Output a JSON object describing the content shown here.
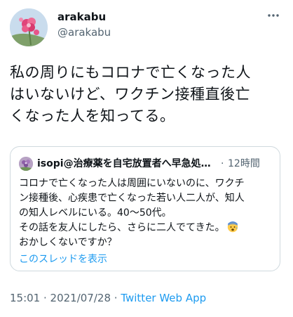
{
  "author": {
    "display_name": "arakabu",
    "handle": "@arakabu",
    "avatar_icon": "flower-avatar-icon"
  },
  "more_icon": "more-horizontal-icon",
  "tweet": {
    "text": "私の周りにもコロナで亡くなった人\nはいないけど、ワクチン接種直後亡\nくなった人を知ってる。"
  },
  "quote": {
    "avatar_icon": "flower-avatar-icon",
    "name": "isopi@治療薬を自宅放置者へ早急処…",
    "separator": "·",
    "time": "12時間",
    "lines": [
      "コロナで亡くなった人は周囲にいないのに、ワクチ",
      "ン接種後、心疾患で亡くなった若い人二人が、知人",
      "の知人レベルにいる。40〜50代。",
      "その話を友人にしたら、さらに二人でてきた。",
      "おかしくないですか？"
    ],
    "emoji_icon": "anxious-face-emoji-icon",
    "show_thread_label": "このスレッドを表示"
  },
  "meta": {
    "time": "15:01 · 2021/07/28",
    "separator": " · ",
    "source": "Twitter Web App"
  },
  "colors": {
    "text": "#0f1419",
    "secondary": "#536471",
    "link": "#1d9bf0",
    "border": "#cfd9de"
  }
}
